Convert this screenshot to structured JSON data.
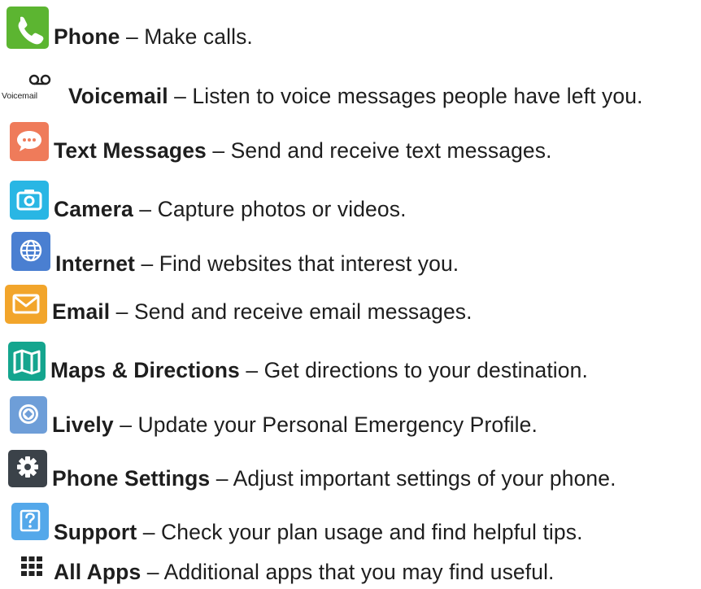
{
  "items": [
    {
      "icon": "phone-icon",
      "name": "Phone",
      "desc": " – Make calls."
    },
    {
      "icon": "voicemail-icon",
      "icon_label": "Voicemail",
      "name": "Voicemail",
      "desc": " – Listen to voice messages people have left you."
    },
    {
      "icon": "text-messages-icon",
      "name": "Text Messages",
      "desc": " – Send and receive text messages."
    },
    {
      "icon": "camera-icon",
      "name": "Camera",
      "desc": " – Capture photos or videos."
    },
    {
      "icon": "globe-icon",
      "name": "Internet",
      "desc": " – Find websites that interest you."
    },
    {
      "icon": "envelope-icon",
      "name": "Email",
      "desc": " – Send and receive email messages."
    },
    {
      "icon": "map-icon",
      "name": "Maps & Directions",
      "desc": " – Get directions to your destination."
    },
    {
      "icon": "lively-icon",
      "name": "Lively",
      "desc": " – Update your Personal Emergency Profile."
    },
    {
      "icon": "gear-icon",
      "name": "Phone Settings",
      "desc": " – Adjust important settings of your phone."
    },
    {
      "icon": "question-icon",
      "name": "Support",
      "desc": " – Check your plan usage and find helpful tips."
    },
    {
      "icon": "grid-icon",
      "name": "All Apps",
      "desc": " – Additional apps that you may find useful."
    }
  ],
  "colors": {
    "phone": "#5cb531",
    "text_messages": "#ef7b5a",
    "camera": "#29b6e4",
    "internet": "#4a7fd1",
    "email": "#f2a52b",
    "maps": "#14a58e",
    "lively": "#6e9ed8",
    "settings": "#3b4249",
    "support": "#54a8ea",
    "all_apps": "#222222"
  }
}
